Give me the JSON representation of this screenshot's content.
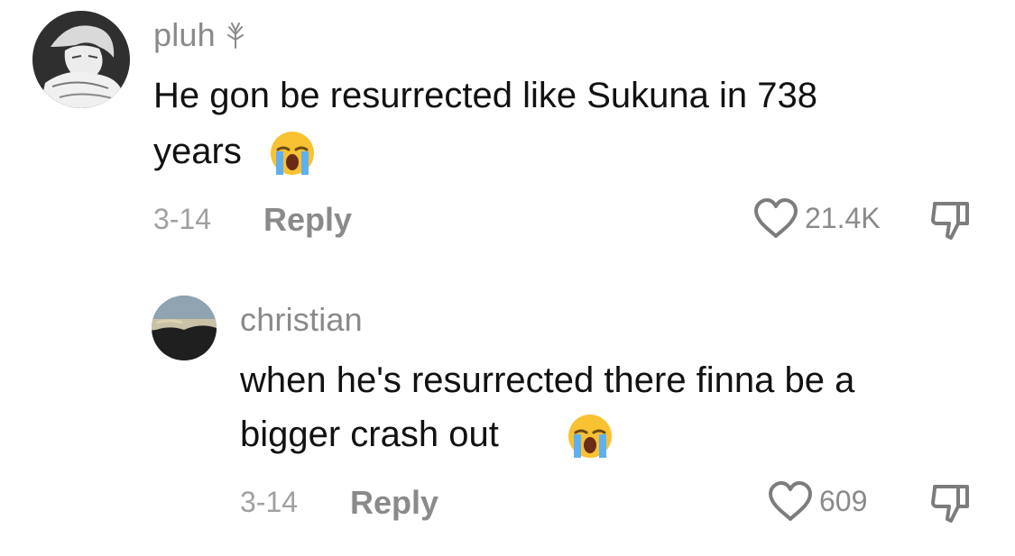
{
  "comments": [
    {
      "username": "pluh",
      "username_badge_icon": "tree-sprout-icon",
      "text_line1": "He gon be resurrected like Sukuna in 738",
      "text_line2": "years",
      "text_emoji_icon": "loudly-crying-face-emoji",
      "date": "3-14",
      "reply_label": "Reply",
      "likes": "21.4K",
      "like_icon": "heart-outline-icon",
      "dislike_icon": "thumbs-down-icon",
      "avatar_icon": "anime-character-avatar"
    },
    {
      "username": "christian",
      "text_line1": "when he's resurrected there finna be a",
      "text_line2": "bigger crash out",
      "text_emoji_icon": "loudly-crying-face-emoji",
      "date": "3-14",
      "reply_label": "Reply",
      "likes": "609",
      "like_icon": "heart-outline-icon",
      "dislike_icon": "thumbs-down-icon",
      "avatar_icon": "sunset-landscape-avatar"
    }
  ],
  "colors": {
    "username": "#8a8a8a",
    "text": "#111111",
    "meta": "#a0a0a0",
    "icon_stroke": "#7c7c7c"
  }
}
